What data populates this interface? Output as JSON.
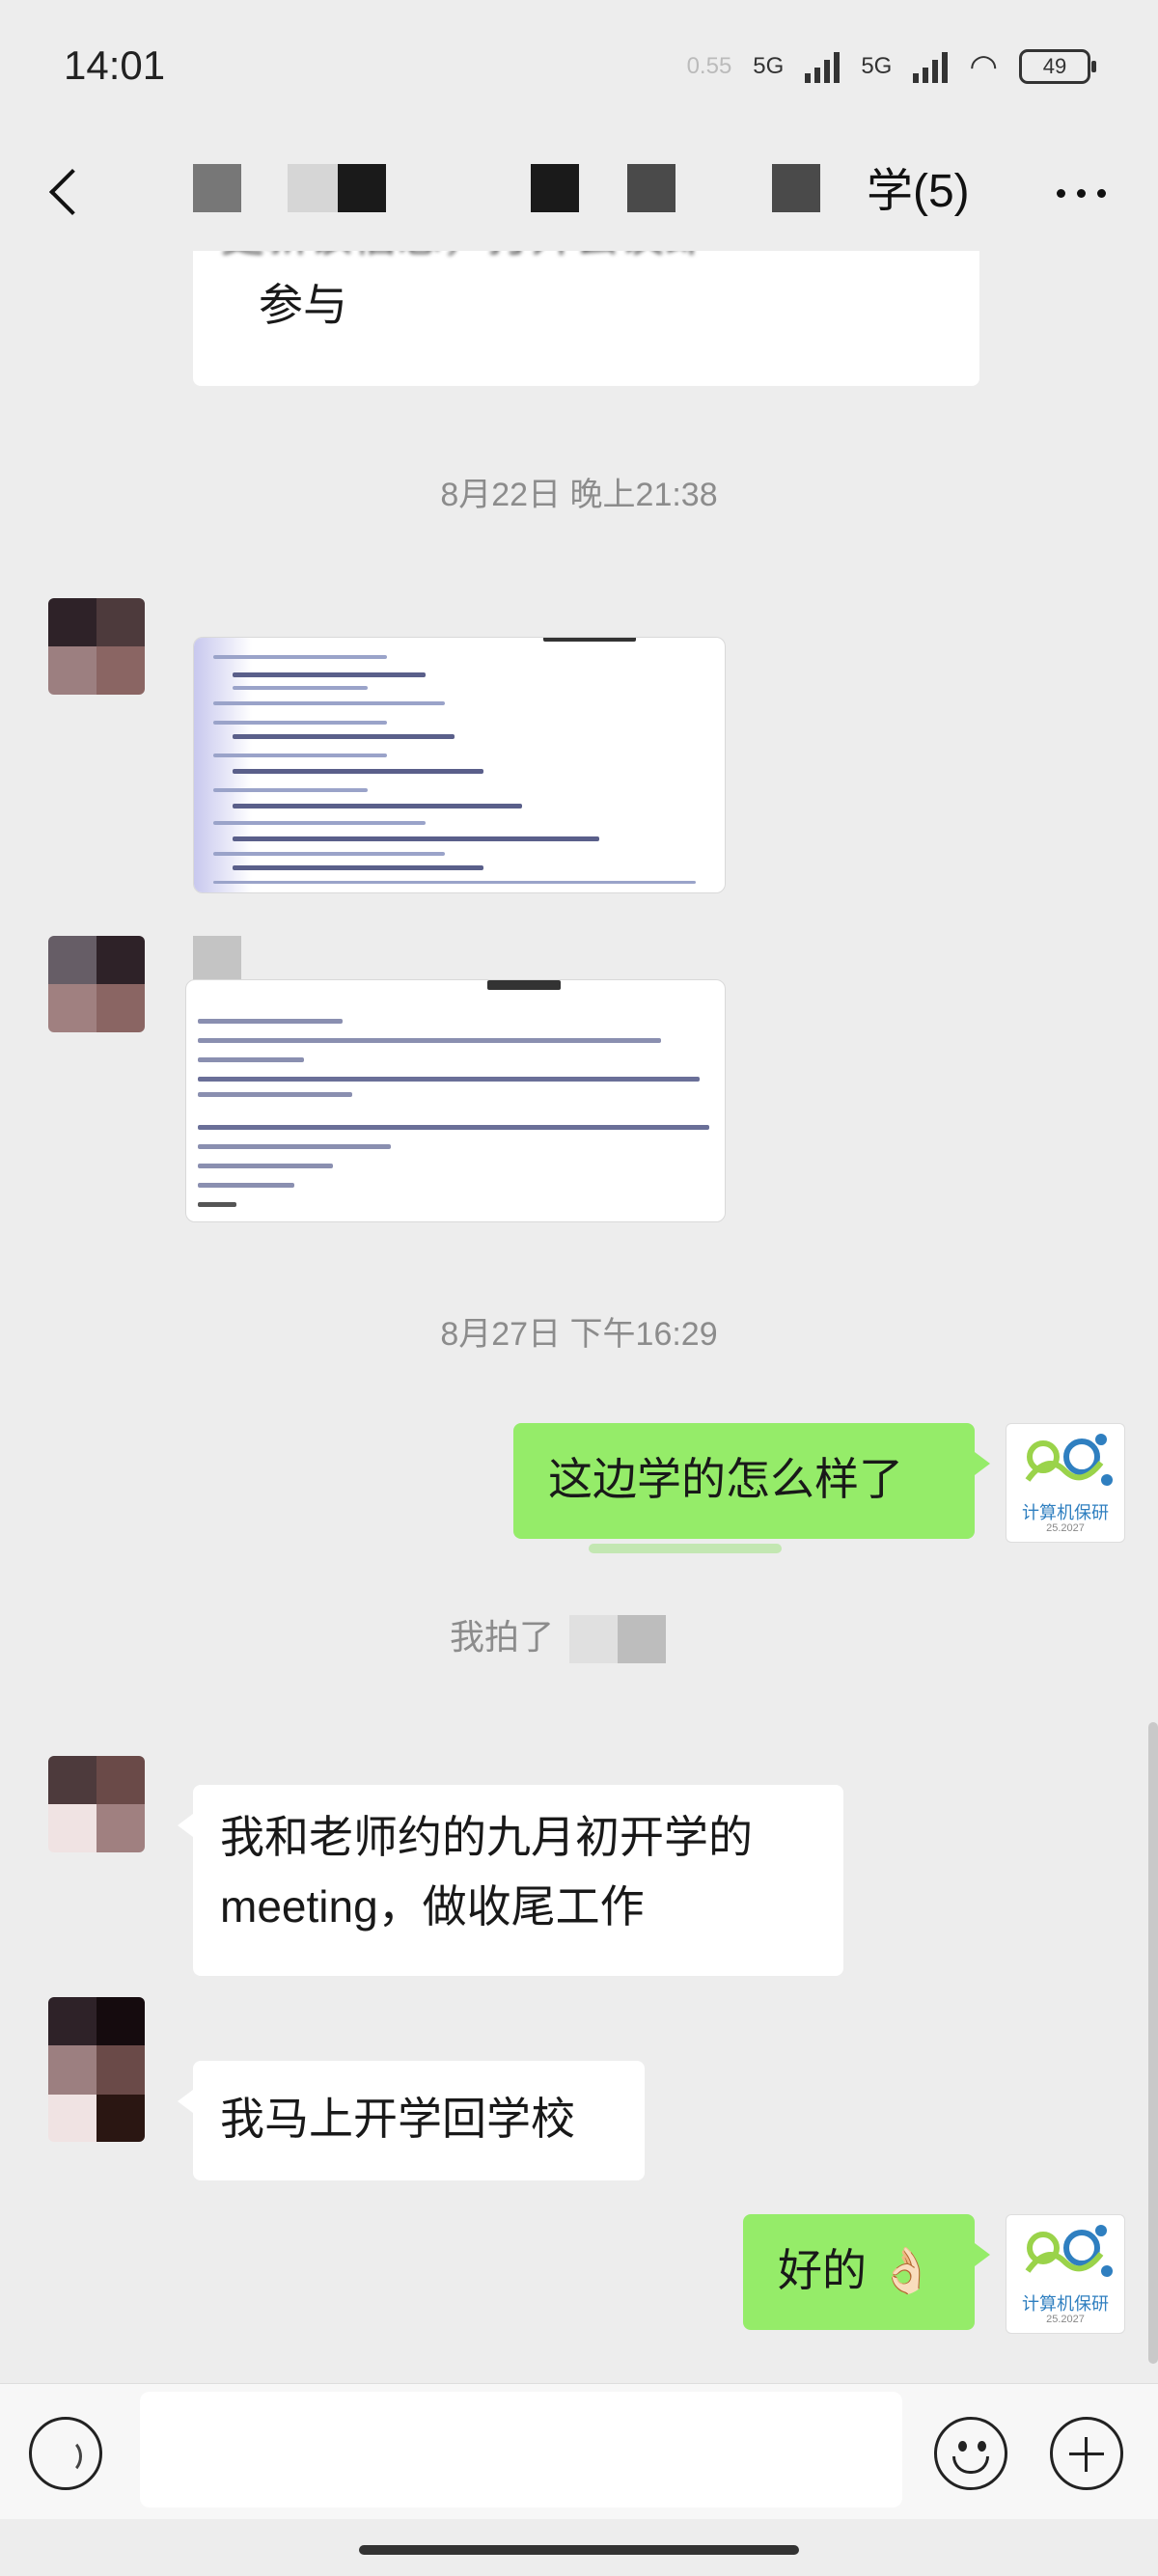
{
  "status_bar": {
    "time": "14:01",
    "net_speed": "0.55",
    "sig1": "5G",
    "sig2": "5G",
    "battery": "49"
  },
  "header": {
    "title": "学(5)"
  },
  "messages": {
    "cut_text": "参与",
    "cut_text_top": "更新该信息，打开会议即",
    "ts1": "8月22日 晚上21:38",
    "ts2": "8月27日 下午16:29",
    "msg_me1": "这边学的怎么样了",
    "pat": "我拍了",
    "msg_them1": "我和老师约的九月初开学的meeting，做收尾工作",
    "msg_them2": "我马上开学回学校",
    "msg_me2": "好的 👌🏻"
  },
  "doc_preview": {
    "lines": [
      "一旦以文本处理",
      "社区中的知识",
      "从知识评估中心与联学机器人建立",
      "Google 视频知识 AI 对环境的影响",
      "ChatGPT 一个 Python 库，用于在强化学习环境中进行人类偏好",
      "GRAPPA 用于文本对齐的 GRaPH 检测编辑 —— 结构化指令跟踪和控制",
      "人工智能生成规则的技术型审视"
    ]
  },
  "brand_avatar": {
    "name": "计算机保研",
    "sub": "25.2027"
  },
  "colors": {
    "bg": "#ededed",
    "green_bubble": "#95ec69",
    "brand_green": "#9ad34a",
    "brand_blue": "#2f7fc0"
  }
}
